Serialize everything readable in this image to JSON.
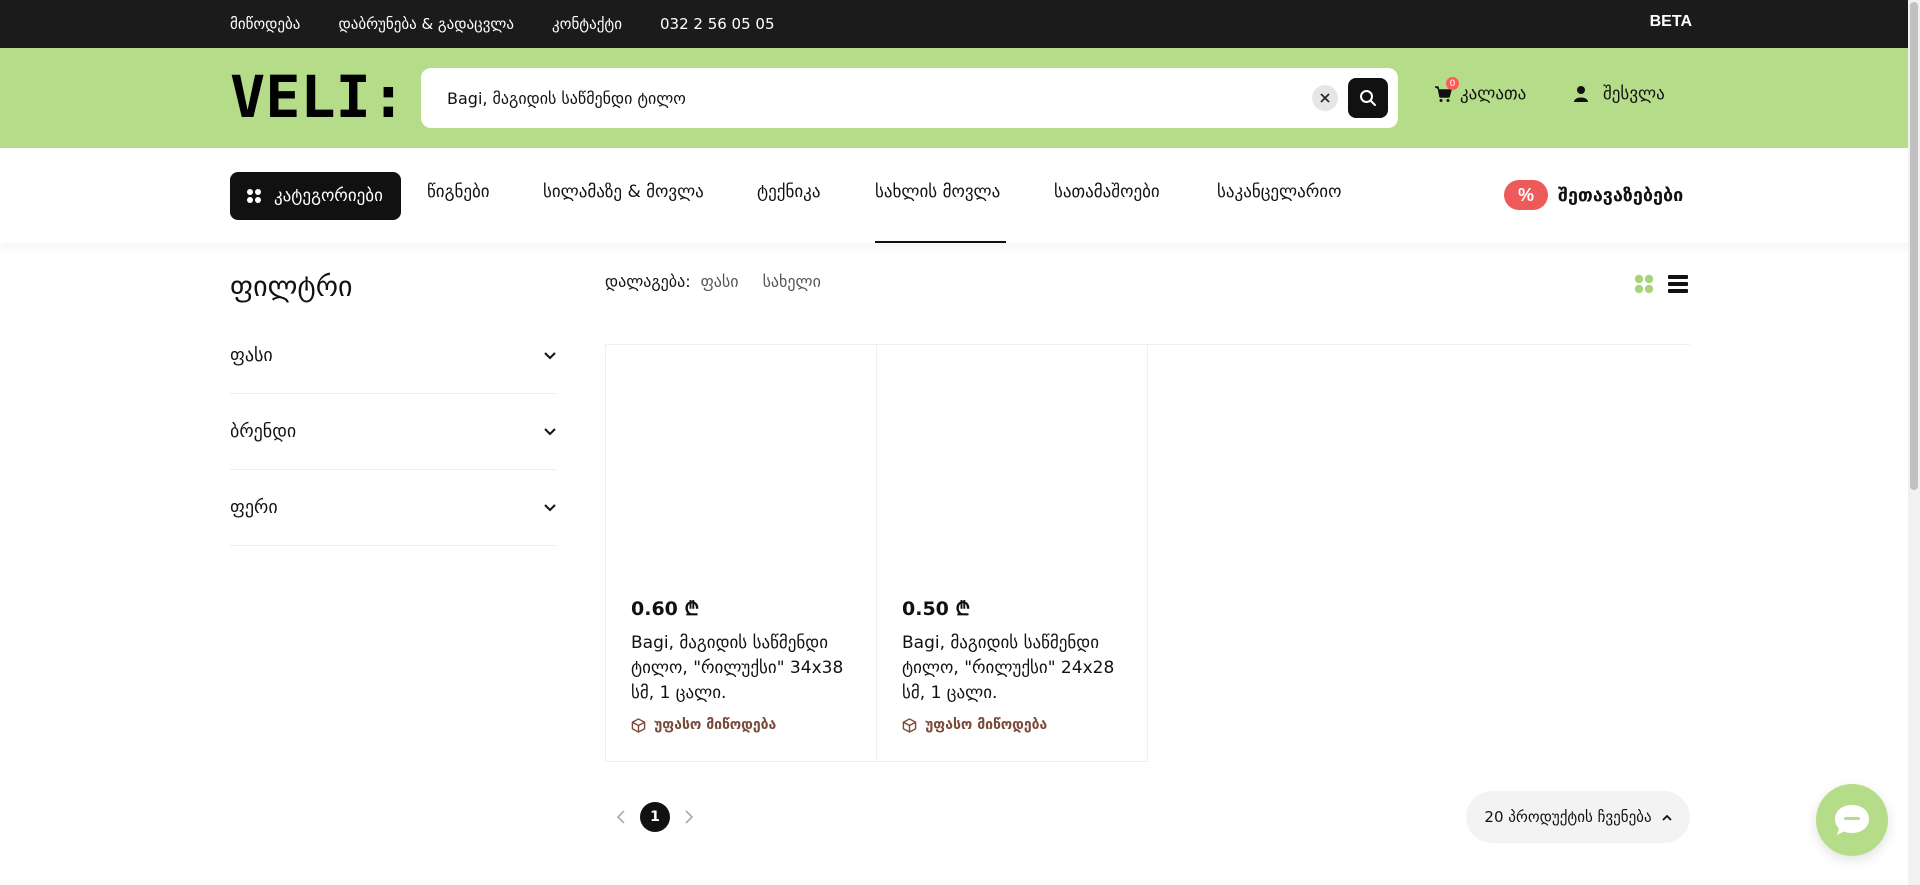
{
  "topbar": {
    "links": [
      "მიწოდება",
      "დაბრუნება & გადაცვლა",
      "კონტაქტი",
      "032 2 56 05 05"
    ],
    "badge": "BETA"
  },
  "header": {
    "logo_text": "VELI:",
    "search": {
      "value": "Bagi, მაგიდის საწმენდი ტილო",
      "clear_icon": "close-icon",
      "submit_icon": "search-icon"
    },
    "cart": {
      "label": "კალათა",
      "count": "0"
    },
    "login": {
      "label": "შესვლა"
    }
  },
  "nav": {
    "categories_label": "კატეგორიები",
    "items": [
      "წიგნები",
      "სილამაზე & მოვლა",
      "ტექნიკა",
      "სახლის მოვლა",
      "სათამაშოები",
      "საკანცელარიო"
    ],
    "active_item": "სახლის მოვლა",
    "deals": {
      "badge": "%",
      "label": "შეთავაზებები"
    }
  },
  "filters": {
    "title": "ფილტრი",
    "facets": [
      "ფასი",
      "ბრენდი",
      "ფერი"
    ]
  },
  "sort": {
    "label": "დალაგება:",
    "options": [
      "ფასი",
      "სახელი"
    ]
  },
  "products": [
    {
      "price": "0.60 ₾",
      "name": "Bagi, მაგიდის საწმენდი ტილო, \"რილუქსი\" 34x38 სმ, 1 ცალი.",
      "shipping": "უფასო მიწოდება"
    },
    {
      "price": "0.50 ₾",
      "name": "Bagi, მაგიდის საწმენდი ტილო, \"რილუქსი\" 24x28 სმ, 1 ცალი.",
      "shipping": "უფასო მიწოდება"
    }
  ],
  "pagination": {
    "current_page": "1",
    "per_page_label": "20 პროდუქტის ჩვენება"
  },
  "colors": {
    "brand_green": "#b5dd89",
    "topbar": "#1b1b1b",
    "deals_red": "#ee5a5a",
    "shipping_brown": "#7a4a38"
  }
}
